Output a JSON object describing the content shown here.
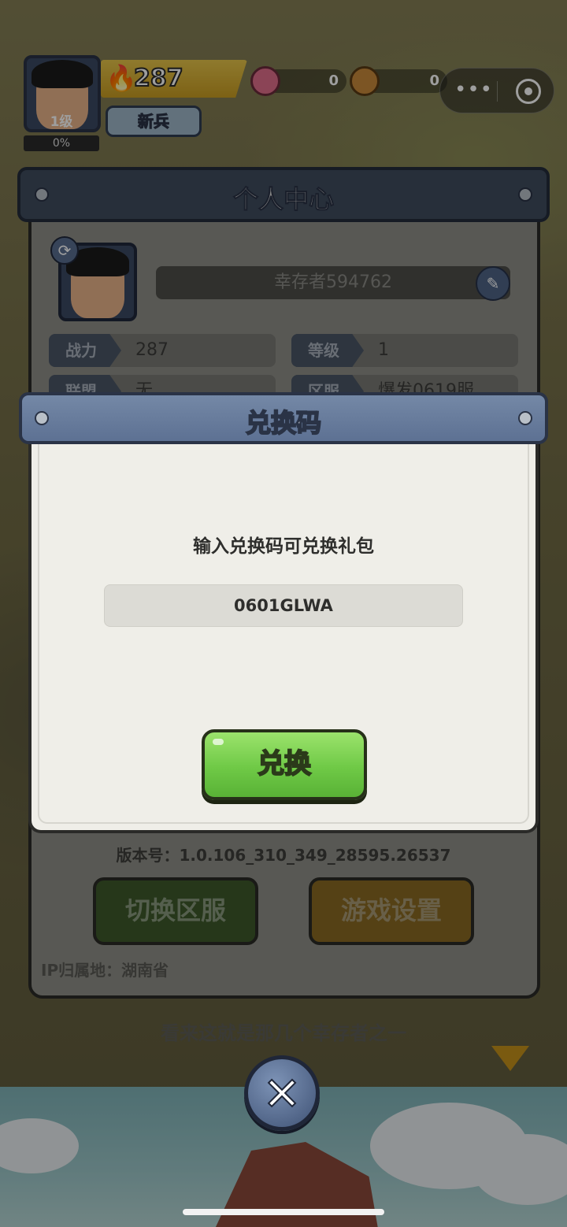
{
  "hud": {
    "player_level": "1级",
    "level_progress": "0%",
    "power": "287",
    "rank_title": "新兵",
    "resources": [
      {
        "icon": "gem-icon",
        "value": "0",
        "color": "#e06e8c"
      },
      {
        "icon": "wood-icon",
        "value": "0",
        "color": "#c8893a"
      }
    ],
    "capsule": {
      "more": "•••",
      "close": "target-icon"
    }
  },
  "personal_center": {
    "title": "个人中心",
    "player_name": "幸存者594762",
    "stats": [
      {
        "label": "战力",
        "value": "287"
      },
      {
        "label": "等级",
        "value": "1"
      },
      {
        "label": "联盟",
        "value": "无"
      },
      {
        "label": "区服",
        "value": "爆发0619服"
      }
    ],
    "version": "版本号：1.0.106_310_349_28595.26537",
    "switch_server_label": "切换区服",
    "game_settings_label": "游戏设置",
    "ip_location": "IP归属地：湖南省"
  },
  "dialogue": "看来这就是那几个幸存者之一",
  "redeem_modal": {
    "title": "兑换码",
    "prompt": "输入兑换码可兑换礼包",
    "code_value": "0601GLWA",
    "redeem_button_label": "兑换"
  },
  "colors": {
    "modal_header": "#6a7e9e",
    "redeem_button": "#6fc946",
    "switch_server_button": "#3e5a2a",
    "settings_button": "#8a6a22"
  }
}
